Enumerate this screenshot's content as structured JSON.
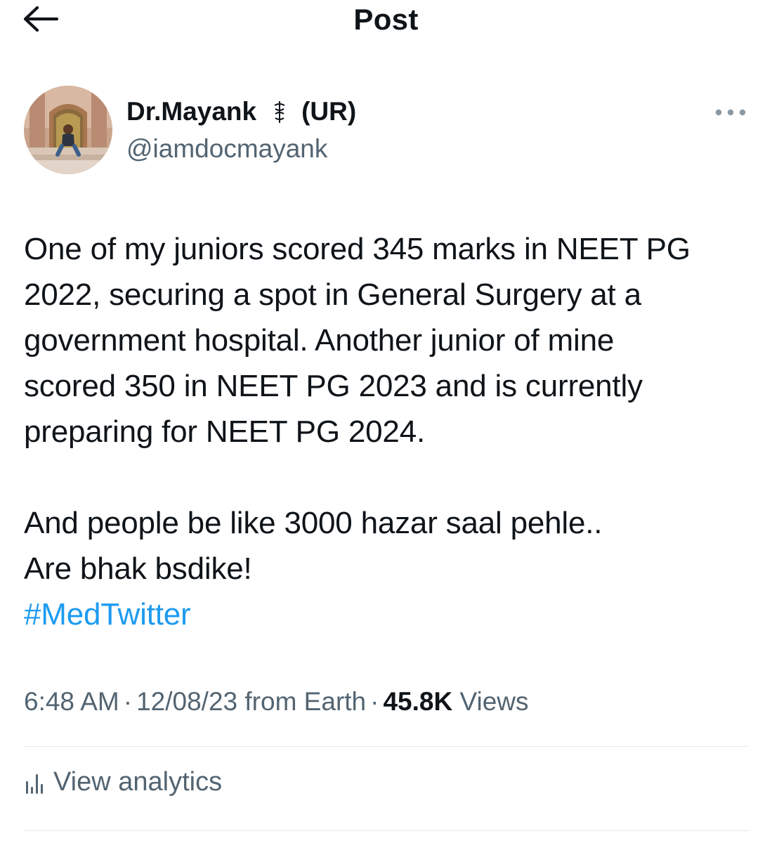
{
  "header": {
    "title": "Post",
    "back_icon": "arrow-left-icon"
  },
  "author": {
    "name": "Dr.Mayank",
    "badge_icon": "caduceus-icon",
    "suffix": "(UR)",
    "handle": "@iamdocmayank",
    "more_icon": "more-horizontal-icon"
  },
  "tweet": {
    "lines": [
      "One of my juniors scored 345 marks in NEET PG",
      "2022, securing a spot in General Surgery at a",
      "government hospital. Another junior of mine",
      "scored 350 in NEET PG 2023 and is currently",
      "preparing for NEET PG 2024."
    ],
    "line2a": "And people be like 3000 hazar saal pehle..",
    "line2b": "Are bhak bsdike!",
    "hashtag": "#MedTwitter"
  },
  "meta": {
    "time": "6:48 AM",
    "date": "12/08/23",
    "source": "from Earth",
    "views_count": "45.8K",
    "views_label": "Views"
  },
  "analytics": {
    "label": "View analytics",
    "icon": "analytics-bars-icon"
  },
  "colors": {
    "text": "#0f1419",
    "muted": "#536471",
    "link": "#1d9bf0",
    "divider": "#e6e9ec"
  }
}
